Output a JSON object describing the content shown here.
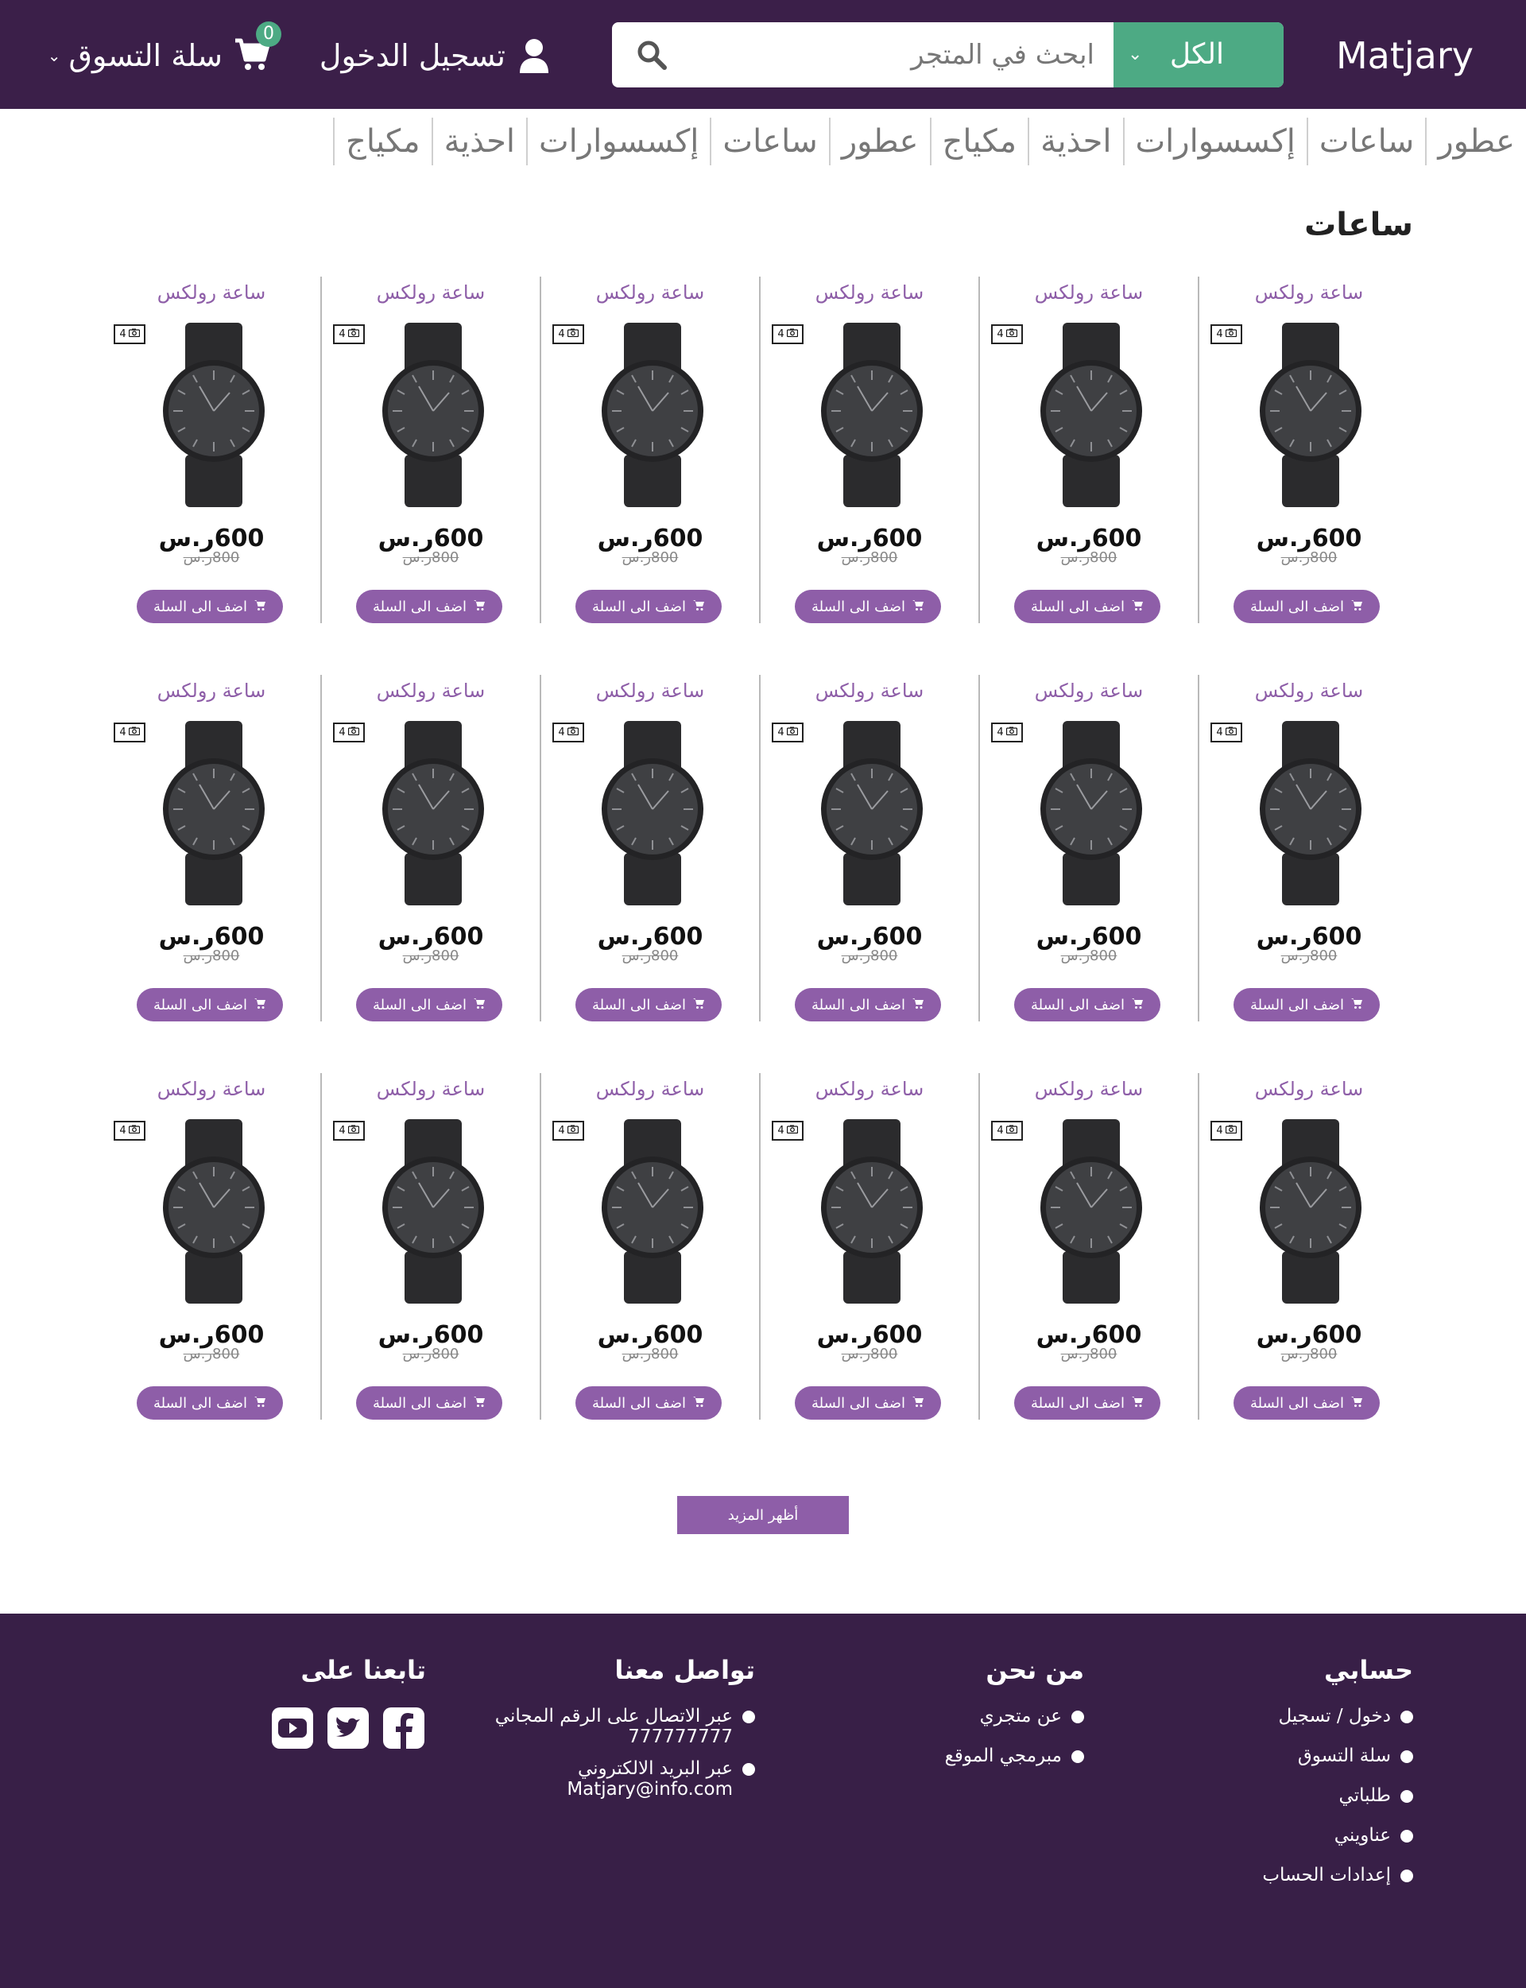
{
  "header": {
    "brand": "Matjary",
    "search": {
      "category": "الكل",
      "placeholder": "ابحث في المتجر"
    },
    "login_label": "تسجيل الدخول",
    "cart_label": "سلة التسوق",
    "cart_count": "0"
  },
  "categories": [
    "عطور",
    "ساعات",
    "إكسسوارات",
    "احذية",
    "مكياج",
    "عطور",
    "ساعات",
    "إكسسوارات",
    "احذية",
    "مكياج"
  ],
  "section_title": "ساعات",
  "product": {
    "name": "ساعة رولكس",
    "price": "600ر.س",
    "old_price": "800ر.س",
    "image_count": "4",
    "add_to_cart": "اضف الى السلة"
  },
  "grid": {
    "rows": 3,
    "columns": 6
  },
  "more_button": "أظهر المزيد",
  "footer": {
    "account": {
      "title": "حسابي",
      "items": [
        "دخول / تسجيل",
        "سلة التسوق",
        "طلباتي",
        "عناويني",
        "إعدادات الحساب"
      ]
    },
    "about": {
      "title": "من نحن",
      "items": [
        "عن متجري",
        "مبرمجي الموقع"
      ]
    },
    "contact": {
      "title": "تواصل معنا",
      "phone_label": "عبر الاتصال على الرقم المجاني",
      "phone": "777777777",
      "email_label": "عبر البريد الالكتروني",
      "email": "Matjary@info.com"
    },
    "follow": {
      "title": "تابعنا على",
      "icons": [
        "facebook-icon",
        "twitter-icon",
        "youtube-icon"
      ]
    }
  },
  "colors": {
    "header_bg": "#3b1f49",
    "accent_green": "#4daa84",
    "accent_purple": "#8e5ea8",
    "footer_bg": "#381f47"
  }
}
